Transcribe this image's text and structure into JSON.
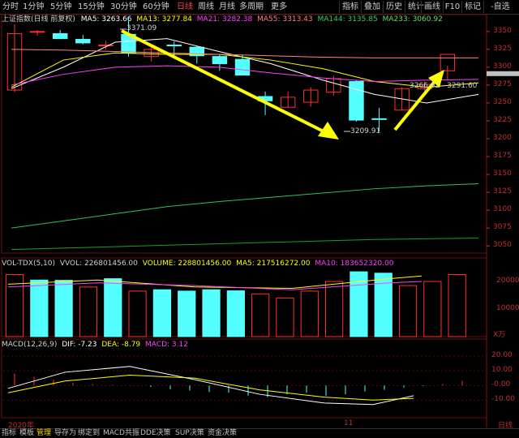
{
  "toolbar": {
    "left_tabs": [
      "分时",
      "1分钟",
      "5分钟",
      "15分钟",
      "30分钟",
      "60分钟",
      "日线",
      "周线",
      "月线",
      "多周期",
      "更多"
    ],
    "active_tab": "日线",
    "right_tabs": [
      "指标",
      "叠加",
      "历史",
      "统计",
      "画线",
      "F10",
      "标记",
      "-自选"
    ]
  },
  "main_panel": {
    "title": "上证指数(日线 前复权)",
    "ma5": "MA5: 3263.66",
    "ma13": "MA13: 3277.84",
    "ma21": "MA21: 3282.38",
    "ma55": "MA55: 3313.43",
    "ma144": "MA144: 3135.85",
    "ma233": "MA233: 3060.92",
    "high_note": "3371.09",
    "low_note": "3209.91",
    "price_tag": "3266.62 - 3291.60",
    "y_ticks": [
      "3350",
      "3325",
      "3300",
      "3275",
      "3250",
      "3225",
      "3200",
      "3175",
      "3150",
      "3125",
      "3100",
      "3075",
      "3050"
    ]
  },
  "volume_panel": {
    "title": "VOL-TDX(5,10)",
    "vvol": "VVOL: 226801456.00",
    "volume": "VOLUME: 228801456.00",
    "ma5": "MA5: 217516272.00",
    "ma10": "MA10: 183652320.00",
    "y_ticks": [
      "20000",
      "10000"
    ],
    "unit": "X万"
  },
  "macd_panel": {
    "title": "MACD(12,26,9)",
    "dif": "DIF: -7.23",
    "dea": "DEA: -8.79",
    "macd": "MACD: 3.12",
    "y_ticks": [
      "20.00",
      "10.00",
      "-0.00",
      "-10.00"
    ]
  },
  "date_axis": {
    "year_label": "2020年",
    "month_label": "11",
    "unit_label": "日线"
  },
  "bottom_tabs": [
    "指标",
    "模板",
    "管理",
    "导存为",
    "绑定到",
    "MACD共振",
    "DDE决策",
    "SUP决策",
    "资金决策"
  ],
  "active_bottom_tab": "管理",
  "colors": {
    "up": "#ff3030",
    "down": "#54ffff",
    "ma5": "#ffffff",
    "ma13": "#ffff00",
    "ma21": "#ff40ff",
    "ma55": "#ff8080",
    "ma144": "#30c060",
    "ma233": "#20a020",
    "arrow": "#ffff00"
  },
  "chart_data": {
    "type": "candlestick",
    "candles": [
      {
        "o": 3268,
        "h": 3360,
        "l": 3265,
        "c": 3347,
        "up": true
      },
      {
        "o": 3350,
        "h": 3352,
        "l": 3344,
        "c": 3350,
        "up": true
      },
      {
        "o": 3347,
        "h": 3352,
        "l": 3340,
        "c": 3340,
        "up": false
      },
      {
        "o": 3339,
        "h": 3345,
        "l": 3332,
        "c": 3334,
        "up": false
      },
      {
        "o": 3331,
        "h": 3337,
        "l": 3325,
        "c": 3330,
        "up": true
      },
      {
        "o": 3346,
        "h": 3371,
        "l": 3315,
        "c": 3320,
        "up": false
      },
      {
        "o": 3315,
        "h": 3328,
        "l": 3308,
        "c": 3325,
        "up": true
      },
      {
        "o": 3331,
        "h": 3336,
        "l": 3315,
        "c": 3330,
        "up": false
      },
      {
        "o": 3328,
        "h": 3330,
        "l": 3305,
        "c": 3316,
        "up": false
      },
      {
        "o": 3315,
        "h": 3318,
        "l": 3295,
        "c": 3305,
        "up": false
      },
      {
        "o": 3311,
        "h": 3318,
        "l": 3290,
        "c": 3289,
        "up": false
      },
      {
        "o": 3259,
        "h": 3266,
        "l": 3233,
        "c": 3253,
        "up": false
      },
      {
        "o": 3244,
        "h": 3266,
        "l": 3244,
        "c": 3258,
        "up": true
      },
      {
        "o": 3251,
        "h": 3272,
        "l": 3245,
        "c": 3268,
        "up": true
      },
      {
        "o": 3265,
        "h": 3288,
        "l": 3260,
        "c": 3284,
        "up": true
      },
      {
        "o": 3280,
        "h": 3282,
        "l": 3224,
        "c": 3226,
        "up": false
      },
      {
        "o": 3228,
        "h": 3243,
        "l": 3210,
        "c": 3228,
        "up": false
      },
      {
        "o": 3240,
        "h": 3272,
        "l": 3240,
        "c": 3270,
        "up": true
      },
      {
        "o": 3270,
        "h": 3280,
        "l": 3262,
        "c": 3276,
        "up": true
      },
      {
        "o": 3295,
        "h": 3302,
        "l": 3283,
        "c": 3318,
        "up": true
      }
    ],
    "volume": [
      {
        "v": 22500,
        "up": true
      },
      {
        "v": 20500,
        "up": false
      },
      {
        "v": 20400,
        "up": false
      },
      {
        "v": 18000,
        "up": true
      },
      {
        "v": 21000,
        "up": false
      },
      {
        "v": 16500,
        "up": true
      },
      {
        "v": 17000,
        "up": false
      },
      {
        "v": 16500,
        "up": false
      },
      {
        "v": 17000,
        "up": false
      },
      {
        "v": 16600,
        "up": false
      },
      {
        "v": 15500,
        "up": true
      },
      {
        "v": 14000,
        "up": true
      },
      {
        "v": 16500,
        "up": true
      },
      {
        "v": 20000,
        "up": true
      },
      {
        "v": 23500,
        "up": false
      },
      {
        "v": 23000,
        "up": false
      },
      {
        "v": 18500,
        "up": true
      },
      {
        "v": 20000,
        "up": true
      },
      {
        "v": 22500,
        "up": true
      }
    ],
    "macd_hist": [
      8,
      6,
      4,
      2,
      1,
      0.5,
      0.2,
      -1,
      -2.5,
      -3.5,
      -4.5,
      -5,
      -7,
      -8,
      -6,
      -5,
      -7,
      -6,
      -4,
      -3,
      -1.5,
      -0.5,
      1,
      3.12
    ]
  }
}
